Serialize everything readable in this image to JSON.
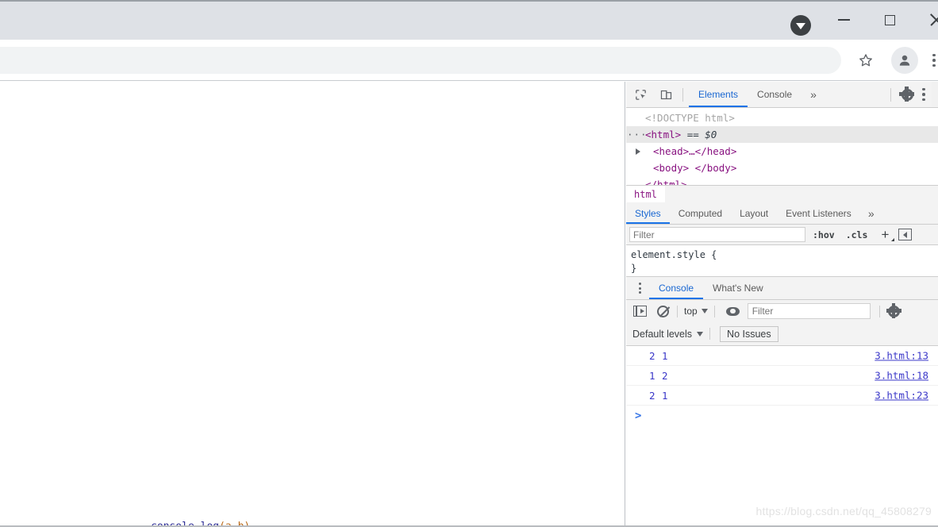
{
  "browser": {
    "download_badge_icon": "download-arrow-icon",
    "window_controls": [
      {
        "name": "minimize",
        "icon": "minimize-icon"
      },
      {
        "name": "maximize",
        "icon": "maximize-icon"
      },
      {
        "name": "close",
        "icon": "close-icon"
      }
    ],
    "omnibox_value": "",
    "bookmark_icon": "star-icon",
    "profile_icon": "account-avatar-icon",
    "menu_icon": "kebab-menu-icon"
  },
  "page": {
    "code_peek_fn": "console.log",
    "code_peek_args": "(a,b)"
  },
  "devtools": {
    "toolbar": {
      "inspect_icon": "inspect-element-icon",
      "device_icon": "device-toolbar-icon",
      "tabs": [
        {
          "label": "Elements",
          "active": true
        },
        {
          "label": "Console",
          "active": false
        }
      ],
      "more_label": "»",
      "settings_icon": "gear-icon",
      "menu_icon": "kebab-menu-icon"
    },
    "dom_tree": [
      {
        "text": "<!DOCTYPE html>",
        "type": "doctype"
      },
      {
        "text": "<html> == $0",
        "type": "element-selected"
      },
      {
        "text": "<head>…</head>",
        "type": "element-collapsed"
      },
      {
        "text": "<body> </body>",
        "type": "element"
      },
      {
        "text": "</html>",
        "type": "element-close"
      }
    ],
    "dom_tokens": {
      "doctype": "<!DOCTYPE html>",
      "html_open": "<html>",
      "html_eq": "==",
      "html_dollar": "$0",
      "head": "<head>…</head>",
      "body": "<body> </body>",
      "html_close": "</html>"
    },
    "breadcrumb": [
      "html"
    ],
    "styles": {
      "tabs": [
        {
          "label": "Styles",
          "active": true
        },
        {
          "label": "Computed",
          "active": false
        },
        {
          "label": "Layout",
          "active": false
        },
        {
          "label": "Event Listeners",
          "active": false
        }
      ],
      "more_label": "»",
      "filter_placeholder": "Filter",
      "filter_value": "",
      "hov_label": ":hov",
      "cls_label": ".cls",
      "new_rule_icon": "plus-icon",
      "dock_icon": "toggle-sidebar-icon",
      "rule_open": "element.style {",
      "rule_close": "}"
    }
  },
  "drawer": {
    "menu_icon": "kebab-menu-icon",
    "tabs": [
      {
        "label": "Console",
        "active": true
      },
      {
        "label": "What's New",
        "active": false
      }
    ],
    "toolbar": {
      "sidebar_icon": "console-sidebar-icon",
      "clear_icon": "clear-console-icon",
      "context_label": "top",
      "eye_icon": "live-expression-icon",
      "filter_placeholder": "Filter",
      "filter_value": "",
      "settings_icon": "gear-icon"
    },
    "levels_label": "Default levels",
    "issues_label": "No Issues",
    "log_rows": [
      {
        "message": "2 1",
        "source": "3.html:13"
      },
      {
        "message": "1 2",
        "source": "3.html:18"
      },
      {
        "message": "2 1",
        "source": "3.html:23"
      }
    ],
    "prompt_caret": ">"
  },
  "watermark": "https://blog.csdn.net/qq_45808279"
}
